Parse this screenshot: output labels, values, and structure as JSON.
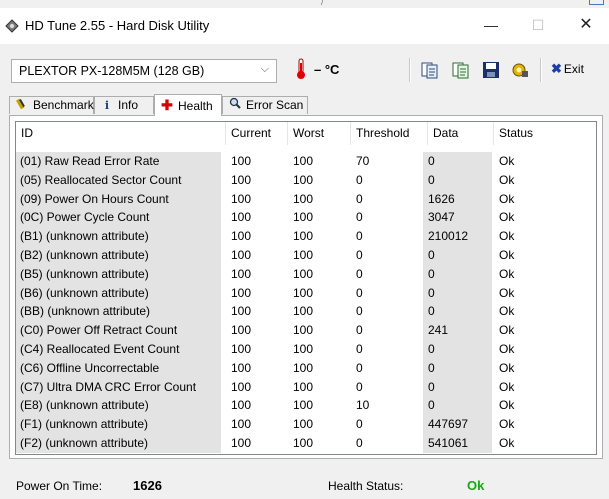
{
  "window": {
    "title": "HD Tune 2.55 - Hard Disk Utility"
  },
  "toolbar": {
    "drive": "PLEXTOR PX-128M5M (128 GB)",
    "temperature": "– °C",
    "exit_label": "Exit",
    "exit_mark": "✖"
  },
  "tabs": [
    {
      "label": "Benchmark",
      "icon": "benchmark-icon"
    },
    {
      "label": "Info",
      "icon": "info-icon"
    },
    {
      "label": "Health",
      "icon": "health-icon",
      "active": true
    },
    {
      "label": "Error Scan",
      "icon": "magnifier-icon"
    }
  ],
  "health": {
    "columns": [
      "ID",
      "Current",
      "Worst",
      "Threshold",
      "Data",
      "Status"
    ],
    "rows": [
      [
        "(01) Raw Read Error Rate",
        "100",
        "100",
        "70",
        "0",
        "Ok"
      ],
      [
        "(05) Reallocated Sector Count",
        "100",
        "100",
        "0",
        "0",
        "Ok"
      ],
      [
        "(09) Power On Hours Count",
        "100",
        "100",
        "0",
        "1626",
        "Ok"
      ],
      [
        "(0C) Power Cycle Count",
        "100",
        "100",
        "0",
        "3047",
        "Ok"
      ],
      [
        "(B1) (unknown attribute)",
        "100",
        "100",
        "0",
        "210012",
        "Ok"
      ],
      [
        "(B2) (unknown attribute)",
        "100",
        "100",
        "0",
        "0",
        "Ok"
      ],
      [
        "(B5) (unknown attribute)",
        "100",
        "100",
        "0",
        "0",
        "Ok"
      ],
      [
        "(B6) (unknown attribute)",
        "100",
        "100",
        "0",
        "0",
        "Ok"
      ],
      [
        "(BB) (unknown attribute)",
        "100",
        "100",
        "0",
        "0",
        "Ok"
      ],
      [
        "(C0) Power Off Retract Count",
        "100",
        "100",
        "0",
        "241",
        "Ok"
      ],
      [
        "(C4) Reallocated Event Count",
        "100",
        "100",
        "0",
        "0",
        "Ok"
      ],
      [
        "(C6) Offline Uncorrectable",
        "100",
        "100",
        "0",
        "0",
        "Ok"
      ],
      [
        "(C7) Ultra DMA CRC Error Count",
        "100",
        "100",
        "0",
        "0",
        "Ok"
      ],
      [
        "(E8) (unknown attribute)",
        "100",
        "100",
        "10",
        "0",
        "Ok"
      ],
      [
        "(F1) (unknown attribute)",
        "100",
        "100",
        "0",
        "447697",
        "Ok"
      ],
      [
        "(F2) (unknown attribute)",
        "100",
        "100",
        "0",
        "541061",
        "Ok"
      ]
    ]
  },
  "status": {
    "power_on_label": "Power On Time:",
    "power_on_value": "1626",
    "health_label": "Health Status:",
    "health_value": "Ok",
    "health_color": "#16a816"
  }
}
